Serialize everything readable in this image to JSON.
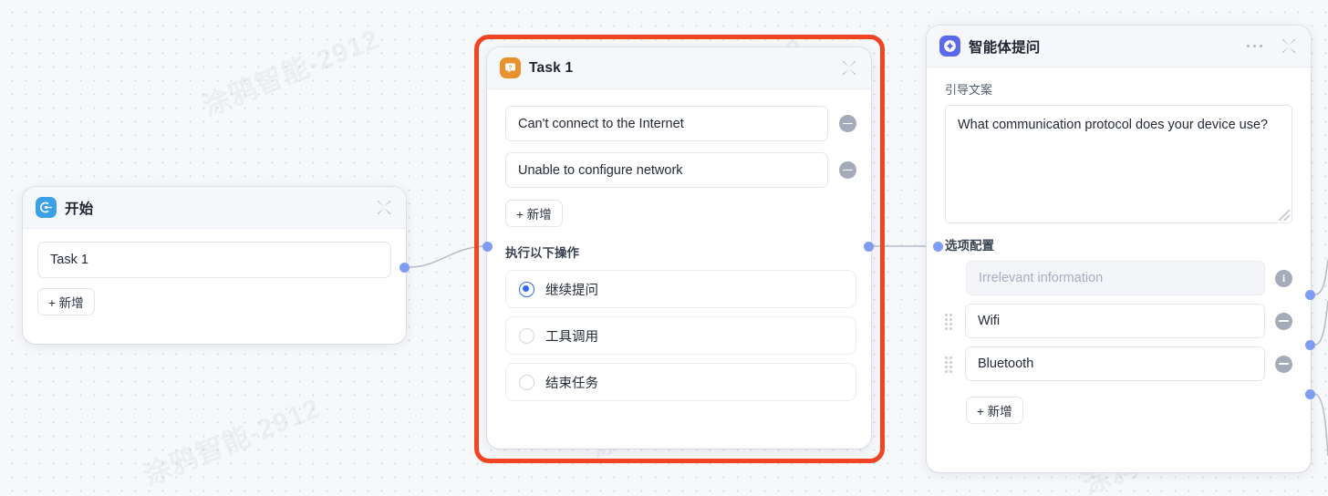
{
  "canvas": {
    "background_color": "#f7f8fa",
    "watermark_text": "涂鸦智能-2912"
  },
  "nodes": {
    "start": {
      "icon": "start-flow-icon",
      "icon_color": "#3ca0e7",
      "title": "开始",
      "collapse_icon": "collapse-chevrons-icon",
      "task_value": "Task 1",
      "add_label": "+ 新增"
    },
    "task": {
      "icon": "question-bubble-icon",
      "icon_color": "#e8922e",
      "title": "Task 1",
      "collapse_icon": "collapse-chevrons-icon",
      "highlight_color": "#f04423",
      "questions": [
        {
          "value": "Can't connect to the Internet",
          "remove_icon": "minus-circle-icon"
        },
        {
          "value": "Unable to configure network",
          "remove_icon": "minus-circle-icon"
        }
      ],
      "add_label": "+ 新增",
      "actions_label": "执行以下操作",
      "actions": [
        {
          "label": "继续提问",
          "selected": true
        },
        {
          "label": "工具调用",
          "selected": false
        },
        {
          "label": "结束任务",
          "selected": false
        }
      ]
    },
    "agent": {
      "icon": "agent-spark-icon",
      "icon_color": "#5b6ae8",
      "title": "智能体提问",
      "more_icon": "more-dots-icon",
      "collapse_icon": "collapse-chevrons-icon",
      "prompt_label": "引导文案",
      "prompt_value": "What communication protocol does your device use?",
      "options_label": "选项配置",
      "fallback_option": {
        "placeholder": "Irrelevant information",
        "info_icon": "info-circle-icon"
      },
      "options": [
        {
          "value": "Wifi",
          "drag_icon": "drag-handle-icon",
          "remove_icon": "minus-circle-icon"
        },
        {
          "value": "Bluetooth",
          "drag_icon": "drag-handle-icon",
          "remove_icon": "minus-circle-icon"
        }
      ],
      "add_label": "+ 新增"
    }
  }
}
